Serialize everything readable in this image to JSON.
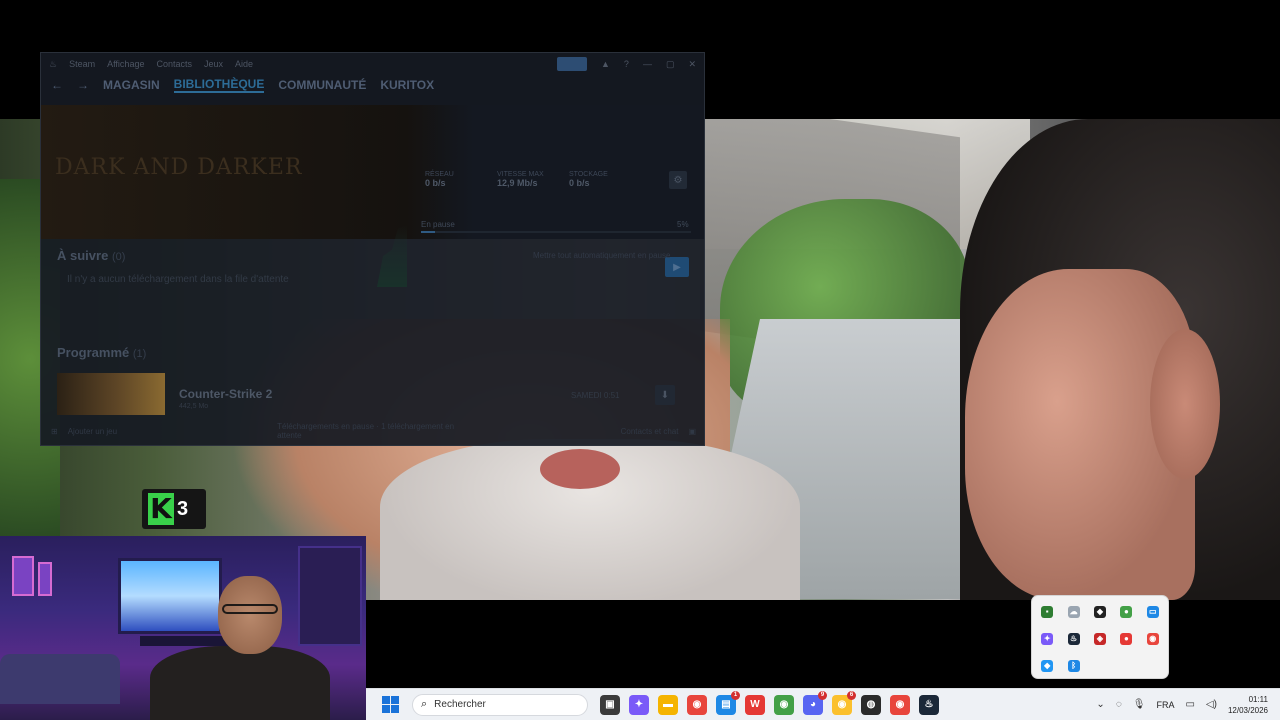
{
  "steam": {
    "menu": [
      "Steam",
      "Affichage",
      "Contacts",
      "Jeux",
      "Aide"
    ],
    "nav": [
      "MAGASIN",
      "BIBLIOTHÈQUE",
      "COMMUNAUTÉ",
      "KURITOX"
    ],
    "stats": {
      "network_label": "RÉSEAU",
      "network_value": "0 b/s",
      "speed_label": "VITESSE MAX",
      "speed_value": "12,9 Mb/s",
      "storage_label": "STOCKAGE",
      "storage_value": "0 b/s"
    },
    "current_game_logo": "DARK AND DARKER",
    "progress": {
      "label": "En pause",
      "percent_text": "5%",
      "percent": 5
    },
    "queue": {
      "title": "À suivre",
      "count": "(0)",
      "empty": "Il n'y a aucun téléchargement dans la file d'attente",
      "link": "Mettre tout automatiquement en pause"
    },
    "scheduled": {
      "title": "Programmé",
      "count": "(1)"
    },
    "game": {
      "name": "Counter-Strike 2",
      "sub": "442,5 Mo",
      "time": "SAMEDI 0:51"
    },
    "footer": {
      "left": "Ajouter un jeu",
      "mid": "Téléchargements en pause · 1 téléchargement en attente",
      "right": "Contacts et chat"
    }
  },
  "overlay": {
    "logo_letter": "K",
    "logo_number": "3"
  },
  "taskbar": {
    "search_placeholder": "Rechercher",
    "language": "FRA",
    "time": "01:11",
    "date": "12/03/2026",
    "apps": [
      {
        "name": "task-view",
        "color": "#3b3b3b",
        "glyph": "▣"
      },
      {
        "name": "copilot",
        "color": "#7a5af8",
        "glyph": "✦"
      },
      {
        "name": "file-explorer",
        "color": "#f5b400",
        "glyph": "▬"
      },
      {
        "name": "chrome",
        "color": "#e8453c",
        "glyph": "◉"
      },
      {
        "name": "app-blue",
        "color": "#1e88e5",
        "glyph": "▤",
        "badge": "1"
      },
      {
        "name": "wps-office",
        "color": "#e53935",
        "glyph": "W"
      },
      {
        "name": "chrome-profile-2",
        "color": "#43a047",
        "glyph": "◉"
      },
      {
        "name": "discord",
        "color": "#5865f2",
        "glyph": "◕",
        "badge": "9"
      },
      {
        "name": "chrome-profile-3",
        "color": "#fbc02d",
        "glyph": "◉",
        "badge": "6"
      },
      {
        "name": "obs",
        "color": "#2b2b2b",
        "glyph": "◍"
      },
      {
        "name": "chrome-profile-4",
        "color": "#e8453c",
        "glyph": "◉"
      },
      {
        "name": "steam",
        "color": "#1b2838",
        "glyph": "♨"
      }
    ]
  },
  "tray_popup": [
    {
      "name": "nvidia-icon",
      "color": "#2e7d32",
      "glyph": "▪"
    },
    {
      "name": "onedrive-icon",
      "color": "#9aa5b1",
      "glyph": "☁"
    },
    {
      "name": "app-red-icon",
      "color": "#222",
      "glyph": "◆"
    },
    {
      "name": "green-status-icon",
      "color": "#43a047",
      "glyph": "●"
    },
    {
      "name": "monitor-icon",
      "color": "#1e88e5",
      "glyph": "▭"
    },
    {
      "name": "copilot-tray-icon",
      "color": "#7a5af8",
      "glyph": "✦"
    },
    {
      "name": "steam-tray-icon",
      "color": "#1b2838",
      "glyph": "♨"
    },
    {
      "name": "shield-tray-icon",
      "color": "#c62828",
      "glyph": "◈"
    },
    {
      "name": "record-tray-icon",
      "color": "#e53935",
      "glyph": "●"
    },
    {
      "name": "chrome-tray-icon",
      "color": "#e8453c",
      "glyph": "◉"
    },
    {
      "name": "security-tray-icon",
      "color": "#2196f3",
      "glyph": "◆"
    },
    {
      "name": "bluetooth-icon",
      "color": "#1e88e5",
      "glyph": "ᛒ"
    }
  ]
}
